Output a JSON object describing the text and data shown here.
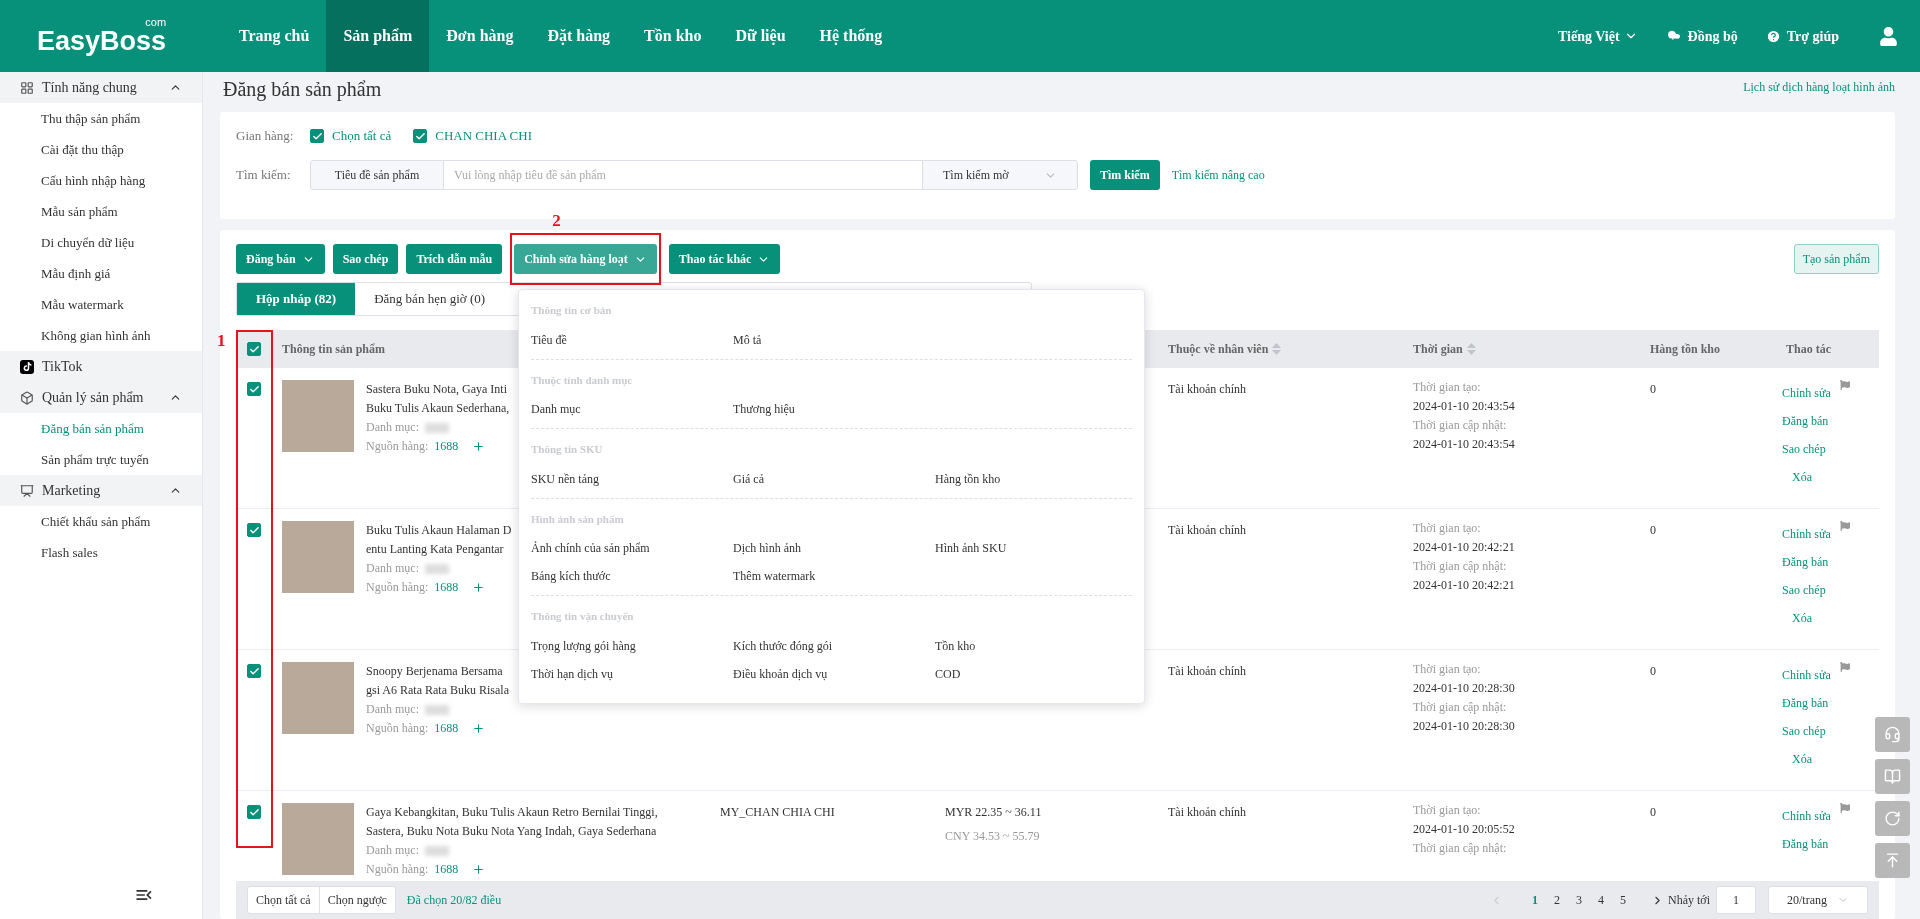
{
  "header": {
    "logo": "EasyBoss",
    "logo_suffix": "com",
    "nav": [
      {
        "label": "Trang chủ",
        "selected": false
      },
      {
        "label": "Sản phẩm",
        "selected": true
      },
      {
        "label": "Đơn hàng",
        "selected": false
      },
      {
        "label": "Đặt hàng",
        "selected": false
      },
      {
        "label": "Tồn kho",
        "selected": false
      },
      {
        "label": "Dữ liệu",
        "selected": false
      },
      {
        "label": "Hệ thống",
        "selected": false
      }
    ],
    "language": "Tiếng Việt",
    "sync": "Đồng bộ",
    "help": "Trợ giúp"
  },
  "sidebar": {
    "groups": [
      {
        "kind": "group",
        "label": "Tính năng chung",
        "expanded": true,
        "children": [
          {
            "label": "Thu thập sản phẩm",
            "selected": false
          },
          {
            "label": "Cài đặt thu thập",
            "selected": false
          },
          {
            "label": "Cấu hình nhập hàng",
            "selected": false
          },
          {
            "label": "Mẫu sản phẩm",
            "selected": false
          },
          {
            "label": "Di chuyển dữ liệu",
            "selected": false
          },
          {
            "label": "Mẫu định giá",
            "selected": false
          },
          {
            "label": "Mẫu watermark",
            "selected": false
          },
          {
            "label": "Không gian hình ảnh",
            "selected": false
          }
        ]
      },
      {
        "kind": "link",
        "label": "TikTok"
      },
      {
        "kind": "group",
        "label": "Quản lý sản phẩm",
        "expanded": true,
        "children": [
          {
            "label": "Đăng bán sản phẩm",
            "selected": true
          },
          {
            "label": "Sản phẩm trực tuyến",
            "selected": false
          }
        ]
      },
      {
        "kind": "group",
        "label": "Marketing",
        "expanded": true,
        "children": [
          {
            "label": "Chiết khấu sản phẩm",
            "selected": false
          },
          {
            "label": "Flash sales",
            "selected": false
          }
        ]
      }
    ]
  },
  "page": {
    "title": "Đăng bán sản phẩm",
    "history_link": "Lịch sử dịch hàng loạt hình ảnh"
  },
  "filter": {
    "store_label": "Gian hàng:",
    "stores": [
      {
        "label": "Chọn tất cả",
        "checked": true
      },
      {
        "label": "CHAN CHIA CHI",
        "checked": true
      }
    ],
    "search_label": "Tìm kiếm:",
    "search_field": "Tiêu đề sản phẩm",
    "placeholder": "Vui lòng nhập tiêu đề sản phẩm",
    "mode": "Tìm kiếm mờ",
    "search_button": "Tìm kiếm",
    "advanced_link": "Tìm kiếm nâng cao"
  },
  "toolbar": {
    "buttons": [
      {
        "label": "Đăng bán",
        "dropdown": true,
        "active": false
      },
      {
        "label": "Sao chép",
        "dropdown": false,
        "active": false
      },
      {
        "label": "Trích dẫn mẫu",
        "dropdown": false,
        "active": false
      },
      {
        "label": "Chỉnh sửa hàng loạt",
        "dropdown": true,
        "active": true
      },
      {
        "label": "Thao tác khác",
        "dropdown": true,
        "active": false
      }
    ],
    "create_button": "Tạo sản phẩm"
  },
  "tabs": [
    {
      "label": "Hộp nháp (82)",
      "selected": true
    },
    {
      "label": "Đăng bán hẹn giờ (0)",
      "selected": false
    }
  ],
  "annotations": [
    {
      "label": "1"
    },
    {
      "label": "2"
    }
  ],
  "batch_menu": {
    "sections": [
      {
        "title": "Thông tin cơ bản",
        "items": [
          "Tiêu đề",
          "Mô tả"
        ]
      },
      {
        "title": "Thuộc tính danh mục",
        "items": [
          "Danh mục",
          "Thương hiệu"
        ]
      },
      {
        "title": "Thông tin SKU",
        "items": [
          "SKU nền tảng",
          "Giá cả",
          "Hàng tồn kho"
        ]
      },
      {
        "title": "Hình ảnh sản phẩm",
        "items": [
          "Ảnh chính của sản phẩm",
          "Dịch hình ảnh",
          "Hình ảnh SKU",
          "Bảng kích thước",
          "Thêm watermark"
        ]
      },
      {
        "title": "Thông tin vận chuyển",
        "items": [
          "Trọng lượng gói hàng",
          "Kích thước đóng gói",
          "Tồn kho",
          "Thời hạn dịch vụ",
          "Điều khoản dịch vụ",
          "COD"
        ]
      }
    ]
  },
  "table": {
    "all_checked": true,
    "columns": {
      "product": "Thông tin sản phẩm",
      "employee": "Thuộc về nhân viên",
      "time": "Thời gian",
      "stock": "Hàng tồn kho",
      "actions": "Thao tác"
    },
    "rows": [
      {
        "checked": true,
        "title_lines": [
          "Sastera Buku Nota, Gaya Inti",
          "Buku Tulis Akaun Sederhana,"
        ],
        "category_label": "Danh mục:",
        "source_label": "Nguồn hàng:",
        "source": "1688",
        "employee": "Tài khoản chính",
        "created_label": "Thời gian tạo:",
        "created": "2024-01-10 20:43:54",
        "updated_label": "Thời gian cập nhật:",
        "updated": "2024-01-10 20:43:54",
        "stock": "0",
        "actions": [
          "Chỉnh sửa",
          "Đăng bán",
          "Sao chép",
          "Xóa"
        ]
      },
      {
        "checked": true,
        "title_lines": [
          "Buku Tulis Akaun Halaman D",
          "entu Lanting Kata Pengantar"
        ],
        "category_label": "Danh mục:",
        "source_label": "Nguồn hàng:",
        "source": "1688",
        "employee": "Tài khoản chính",
        "created_label": "Thời gian tạo:",
        "created": "2024-01-10 20:42:21",
        "updated_label": "Thời gian cập nhật:",
        "updated": "2024-01-10 20:42:21",
        "stock": "0",
        "actions": [
          "Chỉnh sửa",
          "Đăng bán",
          "Sao chép",
          "Xóa"
        ]
      },
      {
        "checked": true,
        "title_lines": [
          "Snoopy Berjenama Bersama",
          "gsi A6 Rata Rata Buku Risala"
        ],
        "category_label": "Danh mục:",
        "source_label": "Nguồn hàng:",
        "source": "1688",
        "employee": "Tài khoản chính",
        "created_label": "Thời gian tạo:",
        "created": "2024-01-10 20:28:30",
        "updated_label": "Thời gian cập nhật:",
        "updated": "2024-01-10 20:28:30",
        "stock": "0",
        "actions": [
          "Chỉnh sửa",
          "Đăng bán",
          "Sao chép",
          "Xóa"
        ]
      },
      {
        "checked": true,
        "title_lines": [
          "Gaya Kebangkitan, Buku Tulis Akaun Retro Bernilai Tinggi,",
          "Sastera, Buku Nota Buku Nota Yang Indah, Gaya Sederhana"
        ],
        "category_label": "Danh mục:",
        "source_label": "Nguồn hàng:",
        "source": "1688",
        "store": "MY_CHAN CHIA CHI",
        "price": "MYR 22.35 ~ 36.11",
        "price_alt": "CNY 34.53 ~ 55.79",
        "employee": "Tài khoản chính",
        "created_label": "Thời gian tạo:",
        "created": "2024-01-10 20:05:52",
        "updated_label": "Thời gian cập nhật:",
        "stock": "0",
        "actions": [
          "Chỉnh sửa",
          "Đăng bán"
        ]
      }
    ]
  },
  "footer": {
    "select_all": "Chọn tất cả",
    "invert": "Chọn ngược",
    "selected_count": "Đã chọn 20/82 điều",
    "pagination": {
      "prev_disabled": true,
      "pages": [
        {
          "label": "1",
          "selected": true
        },
        {
          "label": "2",
          "selected": false
        },
        {
          "label": "3",
          "selected": false
        },
        {
          "label": "4",
          "selected": false
        },
        {
          "label": "5",
          "selected": false
        }
      ],
      "jump_label": "Nhảy tới",
      "jump_value": "1",
      "page_size": "20/trang"
    }
  }
}
